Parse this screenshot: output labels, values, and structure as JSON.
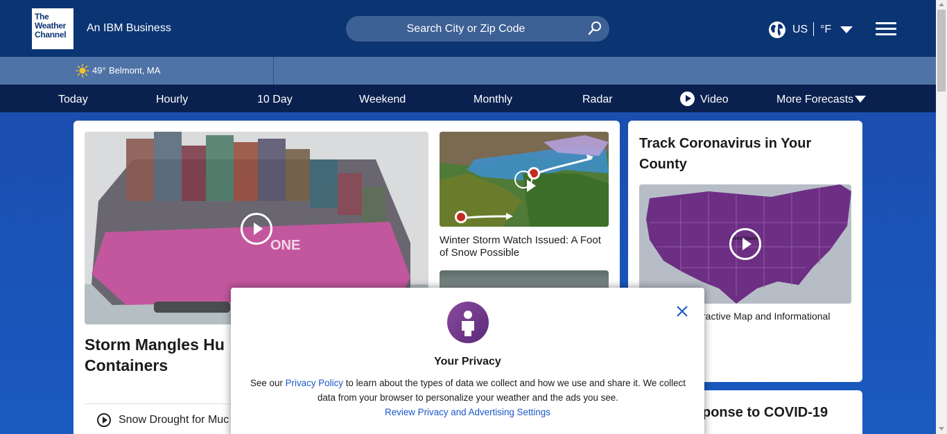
{
  "header": {
    "logo_lines": [
      "The",
      "Weather",
      "Channel"
    ],
    "tagline": "An IBM Business",
    "search_placeholder": "Search City or Zip Code",
    "locale": "US",
    "unit": "°F"
  },
  "location_bar": {
    "temperature": "49°",
    "city": "Belmont, MA"
  },
  "nav": {
    "items": [
      {
        "label": "Today"
      },
      {
        "label": "Hourly"
      },
      {
        "label": "10 Day"
      },
      {
        "label": "Weekend"
      },
      {
        "label": "Monthly"
      },
      {
        "label": "Radar"
      },
      {
        "label": "Video"
      },
      {
        "label": "More Forecasts"
      }
    ]
  },
  "main": {
    "hero_title": "Storm Mangles Hu Containers",
    "hero_title_line1": "Storm Mangles Hu",
    "hero_title_line2": "Containers",
    "hero_ship_text": "ONE",
    "related_item": "Snow Drought for Muc",
    "storm_caption": "Winter Storm Watch Issued: A Foot of Snow Possible"
  },
  "side": {
    "covid_title": "Track Coronavirus in Your County",
    "map_label": "United States",
    "covid_desc": "ractive Map and Informational",
    "response_title": "ponse to COVID-19"
  },
  "privacy_modal": {
    "title": "Your Privacy",
    "text_prefix": "See our ",
    "policy_link": "Privacy Policy",
    "text_suffix": " to learn about the types of data we collect and how we use and share it. We collect data from your browser to personalize your weather and the ads you see.",
    "settings_link": "Review Privacy and Advertising Settings"
  },
  "colors": {
    "header_bg": "#0b3473",
    "location_bar_bg": "#4f73a6",
    "nav_bg": "#0a2150",
    "page_bg": "#1a4fb0",
    "link": "#1a56c9",
    "modal_avatar": "#7a3f90"
  },
  "icons": {
    "search": "search-icon",
    "globe": "globe-icon",
    "menu": "hamburger-menu-icon",
    "weather": "sun-icon",
    "video": "play-icon",
    "close": "close-icon",
    "privacy": "person-icon"
  }
}
